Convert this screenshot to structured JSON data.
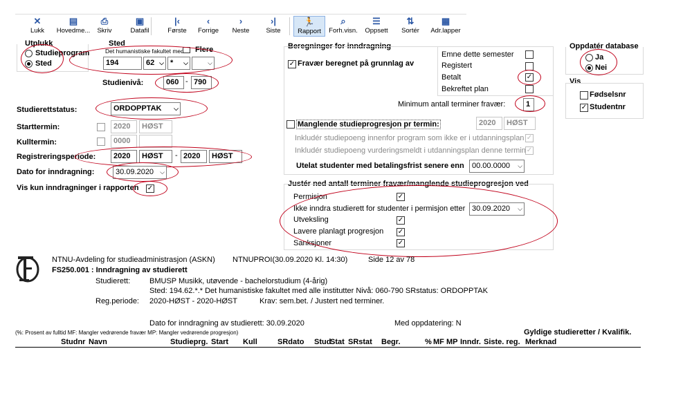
{
  "toolbar": [
    {
      "label": "Lukk",
      "icon": "close-icon",
      "glyph": "✕"
    },
    {
      "label": "Hovedme...",
      "icon": "main-menu-icon",
      "glyph": "▤"
    },
    {
      "label": "Skriv",
      "icon": "printer-icon",
      "glyph": "⎙"
    },
    {
      "label": "Datafil",
      "icon": "save-disk-icon",
      "glyph": "▣"
    },
    {
      "label": "Første",
      "icon": "first-icon",
      "glyph": "|‹"
    },
    {
      "label": "Forrige",
      "icon": "previous-icon",
      "glyph": "‹"
    },
    {
      "label": "Neste",
      "icon": "next-icon",
      "glyph": "›"
    },
    {
      "label": "Siste",
      "icon": "last-icon",
      "glyph": "›|"
    },
    {
      "label": "Rapport",
      "icon": "report-runner-icon",
      "glyph": "🏃"
    },
    {
      "label": "Forh.visn.",
      "icon": "preview-icon",
      "glyph": "⌕"
    },
    {
      "label": "Oppsett",
      "icon": "setup-icon",
      "glyph": "☰"
    },
    {
      "label": "Sortér",
      "icon": "sort-icon",
      "glyph": "⇅"
    },
    {
      "label": "Adr.lapper",
      "icon": "address-labels-icon",
      "glyph": "▦"
    }
  ],
  "utplukk": {
    "title": "Utplukk",
    "opt1": "Studieprogram",
    "opt2": "Sted"
  },
  "sted": {
    "title": "Sted",
    "desc": "Det humanistiske fakultet med",
    "flere": "Flere",
    "f1": "194",
    "f2": "62",
    "f3": "*",
    "f4": ""
  },
  "studieniva": {
    "label": "Studienivå:",
    "from": "060",
    "to": "790"
  },
  "status": {
    "label": "Studierettstatus:",
    "value": "ORDOPPTAK"
  },
  "starttermin": {
    "label": "Starttermin:",
    "year": "2020",
    "term": "HØST"
  },
  "kulltermin": {
    "label": "Kulltermin:",
    "year": "0000"
  },
  "regper": {
    "label": "Registreringsperiode:",
    "y1": "2020",
    "t1": "HØST",
    "y2": "2020",
    "t2": "HØST"
  },
  "dato": {
    "label": "Dato for inndragning:",
    "value": "30.09.2020"
  },
  "viskun": {
    "label": "Vis kun inndragninger i rapporten"
  },
  "beregninger": {
    "title": "Beregninger for inndragning",
    "fravaer": "Fravær beregnet på grunnlag av",
    "emne": "Emne dette semester",
    "registert": "Registert",
    "betalt": "Betalt",
    "bekreftet": "Bekreftet plan",
    "minimum": "Minimum antall terminer fravær:",
    "minimum_val": "1",
    "manglende": "Manglende studieprogresjon pr termin:",
    "mang_year": "2020",
    "mang_term": "HØST",
    "inkl1": "Inkludér studiepoeng innenfor program som ikke er i utdanningsplan",
    "inkl2": "Inkludér studiepoeng vurderingsmeldt i utdanningsplan denne termin",
    "utelat": "Utelat studenter med betalingsfrist senere enn",
    "utelat_val": "00.00.0000"
  },
  "juster": {
    "title": "Justér ned antall terminer fravær/manglende studieprogresjon ved",
    "permisjon": "Permisjon",
    "ikke": "Ikke inndra studierett for studenter i permisjon etter",
    "ikke_val": "30.09.2020",
    "utveksling": "Utveksling",
    "lavere": "Lavere planlagt progresjon",
    "sanksjoner": "Sanksjoner"
  },
  "oppdater": {
    "title": "Oppdatér database",
    "ja": "Ja",
    "nei": "Nei"
  },
  "vis": {
    "title": "Vis",
    "fodsel": "Fødselsnr",
    "studentnr": "Studentnr"
  },
  "report": {
    "org": "NTNU-Avdeling for studieadministrasjon (ASKN)",
    "ntnu": "NTNUPROI(30.09.2020 Kl. 14:30)",
    "side": "Side 12 av 78",
    "title": "FS250.001 : Inndragning av studierett",
    "sr_label": "Studierett:",
    "sr_val": "BMUSP Musikk, utøvende - bachelorstudium (4-årig)",
    "sted_line": "Sted: 194.62.*.* Det humanistiske fakultet med alle institutter Nivå: 060-790 SRstatus: ORDOPPTAK",
    "rp_label": "Reg.periode:",
    "rp_val": "2020-HØST - 2020-HØST",
    "krav": "Krav:  sem.bet. / Justert ned terminer.",
    "dato_line": "Dato for inndragning av studierett: 30.09.2020",
    "med": "Med oppdatering: N",
    "legend": "(%: Prosent av fulltid MF: Mangler vedrørende fravær MP: Mangler vedrørende progresjon)",
    "gyldige": "Gyldige studieretter / Kvalifik.",
    "cols": [
      "Studnr",
      "Navn",
      "Studieprg.",
      "Start",
      "Kull",
      "SRdato",
      "Stud",
      "Stat",
      "SRstat",
      "Begr.",
      "%",
      "MF",
      "MP",
      "Inndr.",
      "Siste. reg.",
      "Merknad"
    ]
  }
}
